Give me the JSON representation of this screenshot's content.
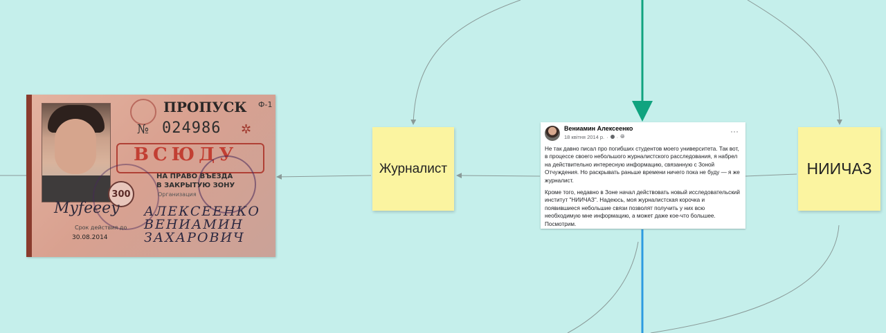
{
  "canvas": {
    "background": "#c5efeb",
    "accent_green": "#10a37f",
    "accent_blue": "#2c9be0"
  },
  "notes": {
    "journalist": "Журналист",
    "niichaz": "НИИЧАЗ"
  },
  "pass": {
    "title": "ПРОПУСК",
    "form": "Ф-1",
    "no": "№",
    "number": "024986",
    "vsyuda": "ВСЮДУ",
    "right_line_1": "НА ПРАВО ВЪЕЗДА",
    "right_line_2": "В ЗАКРЫТУЮ ЗОНУ",
    "organization": "Организация",
    "badge": "300",
    "validity": "Срок действия до",
    "date": "30.08.2014",
    "signature": "Myfeeеу",
    "handwriting": "АЛЕКСЕЕНКО ВЕНИАМИН ЗАХАРОВИЧ"
  },
  "post": {
    "author": "Вениамин Алексеенко",
    "date": "18 квітня 2014 р.",
    "more": "···",
    "paragraphs": [
      "Не так давно писал про погибших студентов моего университета. Так вот, в процессе своего небольшого журналистского расследования, я набрел на действительно интересную информацию, связанную с Зоной Отчуждения. Но раскрывать раньше времени ничего пока не буду — я же журналист.",
      "Кроме того, недавно в Зоне начал действовать новый исследовательский институт \"НИИЧАЗ\". Надеюсь, моя журналистская корочка и появившиеся небольшие связи позволят получить у них всю необходимую мне информацию, а может даже кое-что большее. Посмотрим."
    ]
  }
}
